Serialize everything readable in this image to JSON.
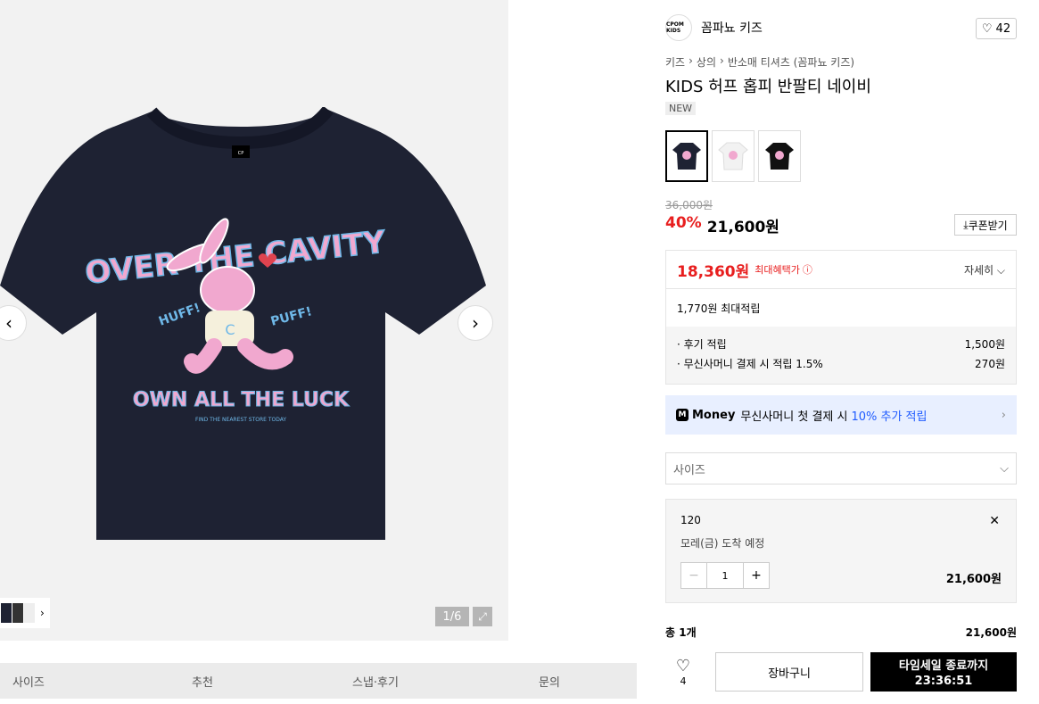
{
  "gallery": {
    "counter": "1/6",
    "prev_icon": "chevron-left-icon",
    "next_icon": "chevron-right-icon",
    "fullscreen_icon": "expand-icon",
    "tee_texts": {
      "top_arc": "OVER THE CAVITY",
      "huff": "HUFF!",
      "puff": "PUFF!",
      "bottom": "OWN ALL THE LUCK",
      "small": "FIND THE NEAREST STORE TODAY",
      "neck_label": "CP"
    },
    "colors": {
      "shirt": "#1e2233",
      "rabbit": "#f1a8cf",
      "accent_blue": "#6fb8e8"
    }
  },
  "tabs": [
    {
      "label": "사이즈"
    },
    {
      "label": "추천"
    },
    {
      "label": "스냅·후기"
    },
    {
      "label": "문의"
    }
  ],
  "brand": {
    "logo_text": "CPOM KIDS",
    "name": "꼼파뇨 키즈"
  },
  "likes": {
    "icon": "heart-icon",
    "count": "42"
  },
  "breadcrumb": [
    "키즈",
    "상의",
    "반소매 티셔츠 (꼼파뇨 키즈)"
  ],
  "product": {
    "title": "KIDS 허프 홉피 반팔티 네이비",
    "badge": "NEW",
    "original_price": "36,000원",
    "discount": "40%",
    "sale_price": "21,600원",
    "coupon_label": "쿠폰받기"
  },
  "benefit": {
    "max_price": "18,360원",
    "max_label": "최대혜택가",
    "detail_label": "자세히",
    "points_label": "1,770원 최대적립",
    "lines": [
      {
        "label": "· 후기 적립",
        "value": "1,500원"
      },
      {
        "label": "· 무신사머니 결제 시 적립 1.5%",
        "value": "270원"
      }
    ]
  },
  "money": {
    "badge": "M",
    "title": "Money",
    "desc": "무신사머니 첫 결제 시",
    "highlight": "10% 추가 적립"
  },
  "size_select": {
    "placeholder": "사이즈"
  },
  "option": {
    "name": "120",
    "arrival": "모레(금) 도착 예정",
    "qty": "1",
    "price": "21,600원"
  },
  "total": {
    "label": "총 1개",
    "value": "21,600원"
  },
  "buy": {
    "wish_count": "4",
    "cart_label": "장바구니",
    "buy_line1": "타임세일 종료까지",
    "buy_line2": "23:36:51"
  }
}
